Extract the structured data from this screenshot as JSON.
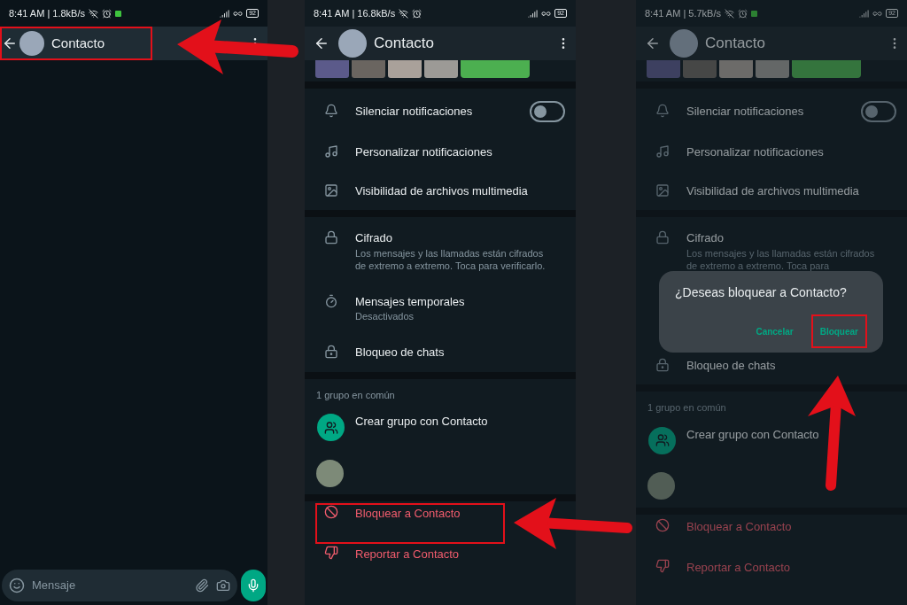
{
  "screens": [
    {
      "kind": "chat",
      "dimmed": false,
      "status_bar": {
        "text": "8:41 AM | 1.8kB/s",
        "notification": true,
        "battery": "92"
      },
      "header": {
        "title": "Contacto",
        "highlighted": true
      },
      "composer": {
        "placeholder": "Mensaje"
      }
    },
    {
      "kind": "info",
      "dimmed": false,
      "status_bar": {
        "text": "8:41 AM | 16.8kB/s",
        "notification": false,
        "battery": "92"
      },
      "header": {
        "title": "Contacto",
        "highlighted": false
      },
      "sections": [
        {
          "rows": [
            {
              "kind": "toggle",
              "title": "Silenciar notificaciones",
              "on": false
            },
            {
              "kind": "music",
              "title": "Personalizar notificaciones"
            },
            {
              "kind": "image",
              "title": "Visibilidad de archivos multimedia"
            }
          ]
        },
        {
          "rows": [
            {
              "kind": "lock",
              "title": "Cifrado",
              "subtitle": "Los mensajes y las llamadas están cifrados de extremo a extremo. Toca para verificarlo."
            },
            {
              "kind": "timer",
              "title": "Mensajes temporales",
              "subtitle": "Desactivados"
            },
            {
              "kind": "chatlock",
              "title": "Bloqueo de chats"
            }
          ]
        },
        {
          "label": "1 grupo en común",
          "rows": [
            {
              "kind": "group_new",
              "title": "Crear grupo con Contacto"
            },
            {
              "kind": "group"
            }
          ]
        },
        {
          "rows": [
            {
              "kind": "block",
              "title": "Bloquear a Contacto",
              "highlighted": true
            },
            {
              "kind": "report",
              "title": "Reportar a Contacto",
              "highlighted": false
            }
          ]
        }
      ]
    },
    {
      "kind": "info",
      "dimmed": true,
      "status_bar": {
        "text": "8:41 AM | 5.7kB/s",
        "notification": true,
        "battery": "92"
      },
      "header": {
        "title": "Contacto",
        "highlighted": false
      },
      "sections": [
        {
          "rows": [
            {
              "kind": "toggle",
              "title": "Silenciar notificaciones",
              "on": false
            },
            {
              "kind": "music",
              "title": "Personalizar notificaciones"
            },
            {
              "kind": "image",
              "title": "Visibilidad de archivos multimedia"
            }
          ]
        },
        {
          "rows": [
            {
              "kind": "lock",
              "title": "Cifrado",
              "subtitle": "Los mensajes y las llamadas están cifrados de extremo a extremo. Toca para"
            },
            {
              "kind": "hidden"
            },
            {
              "kind": "chatlock",
              "title": "Bloqueo de chats"
            }
          ]
        },
        {
          "label": "1 grupo en común",
          "rows": [
            {
              "kind": "group_new",
              "title": "Crear grupo con Contacto"
            },
            {
              "kind": "group"
            }
          ]
        },
        {
          "rows": [
            {
              "kind": "block",
              "title": "Bloquear a Contacto",
              "highlighted": false
            },
            {
              "kind": "report",
              "title": "Reportar a Contacto",
              "highlighted": false
            }
          ]
        }
      ],
      "dialog": {
        "title": "¿Deseas bloquear a Contacto?",
        "buttons": [
          {
            "label": "Cancelar",
            "highlighted": false
          },
          {
            "label": "Bloquear",
            "highlighted": true
          }
        ]
      }
    }
  ]
}
